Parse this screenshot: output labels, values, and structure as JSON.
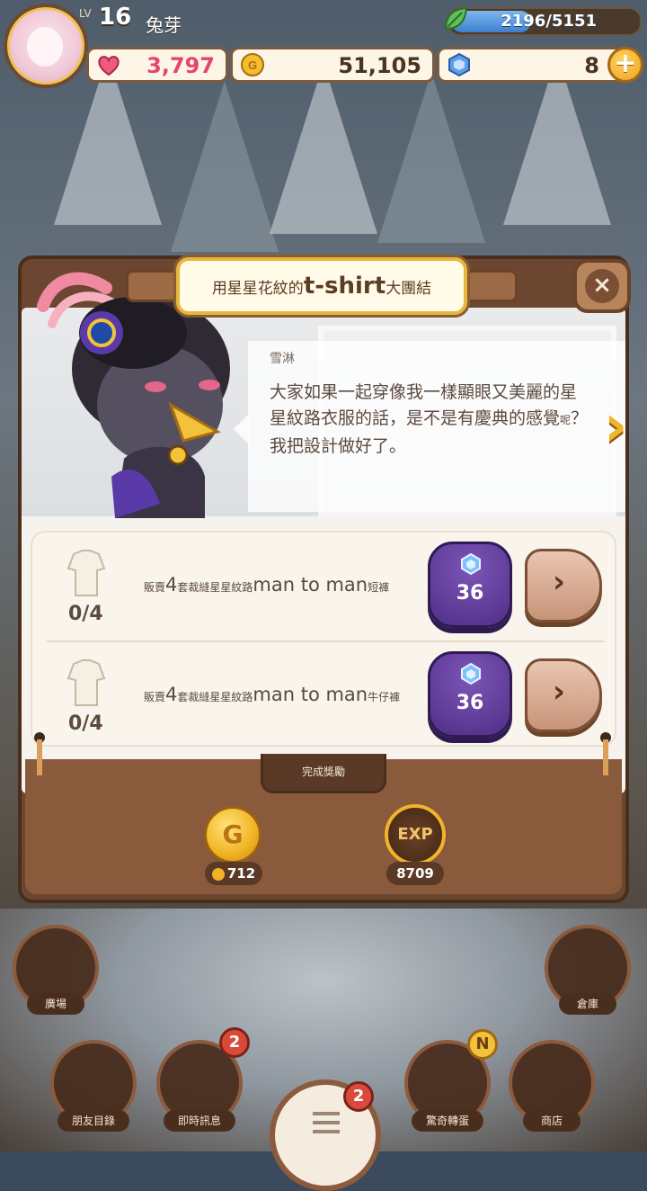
{
  "player": {
    "level_label": "LV",
    "level": "16",
    "name": "兔芽",
    "exp_text": "2196/5151",
    "exp_progress": 0.426
  },
  "resources": {
    "hearts": "3,797",
    "coins": "51,105",
    "gems": "8",
    "add_gems_symbol": "+"
  },
  "quest": {
    "title_prefix": "用星星花紋的",
    "title_main": "t-shirt",
    "title_suffix": "大團結",
    "speaker": "雪淋",
    "dialogue_main": "大家如果一起穿像我一樣顯眼又美麗的星星紋路衣服的話，是不是有慶典的感覺",
    "dialogue_small": "呢",
    "dialogue_end": "？我把設計做好了。",
    "next_symbol": "›",
    "close_symbol": "×"
  },
  "tasks": [
    {
      "progress": "0/4",
      "prefix": "販賣",
      "count": "4",
      "middle": "套裁縫星星紋路",
      "item": "man to man",
      "suffix": "短褲",
      "gem_cost": "36",
      "go_symbol": "›"
    },
    {
      "progress": "0/4",
      "prefix": "販賣",
      "count": "4",
      "middle": "套裁縫星星紋路",
      "item": "man to man",
      "suffix": "牛仔褲",
      "gem_cost": "36",
      "go_symbol": "›"
    }
  ],
  "rewards": {
    "section_label": "完成獎勵",
    "coin_symbol": "G",
    "coin_amount": "712",
    "exp_symbol": "EXP",
    "exp_amount": "8709"
  },
  "nav": {
    "plaza": "廣場",
    "warehouse": "倉庫",
    "friends": "朋友目錄",
    "messages": "即時訊息",
    "messages_badge": "2",
    "menu_badge": "2",
    "wonder": "驚奇轉蛋",
    "wonder_badge": "N",
    "shop": "商店"
  },
  "colors": {
    "frame_brown": "#6b4630",
    "accent_gold": "#f2b42a",
    "gem_button_purple": "#5a3792",
    "heart_pink": "#e5466d",
    "exp_blue": "#3e7fcf"
  },
  "icons": [
    "heart-icon",
    "coin-icon",
    "gem-icon",
    "plus-icon",
    "leaf-icon",
    "close-icon",
    "chevron-right-icon",
    "shirt-icon",
    "exp-icon",
    "menu-icon"
  ]
}
